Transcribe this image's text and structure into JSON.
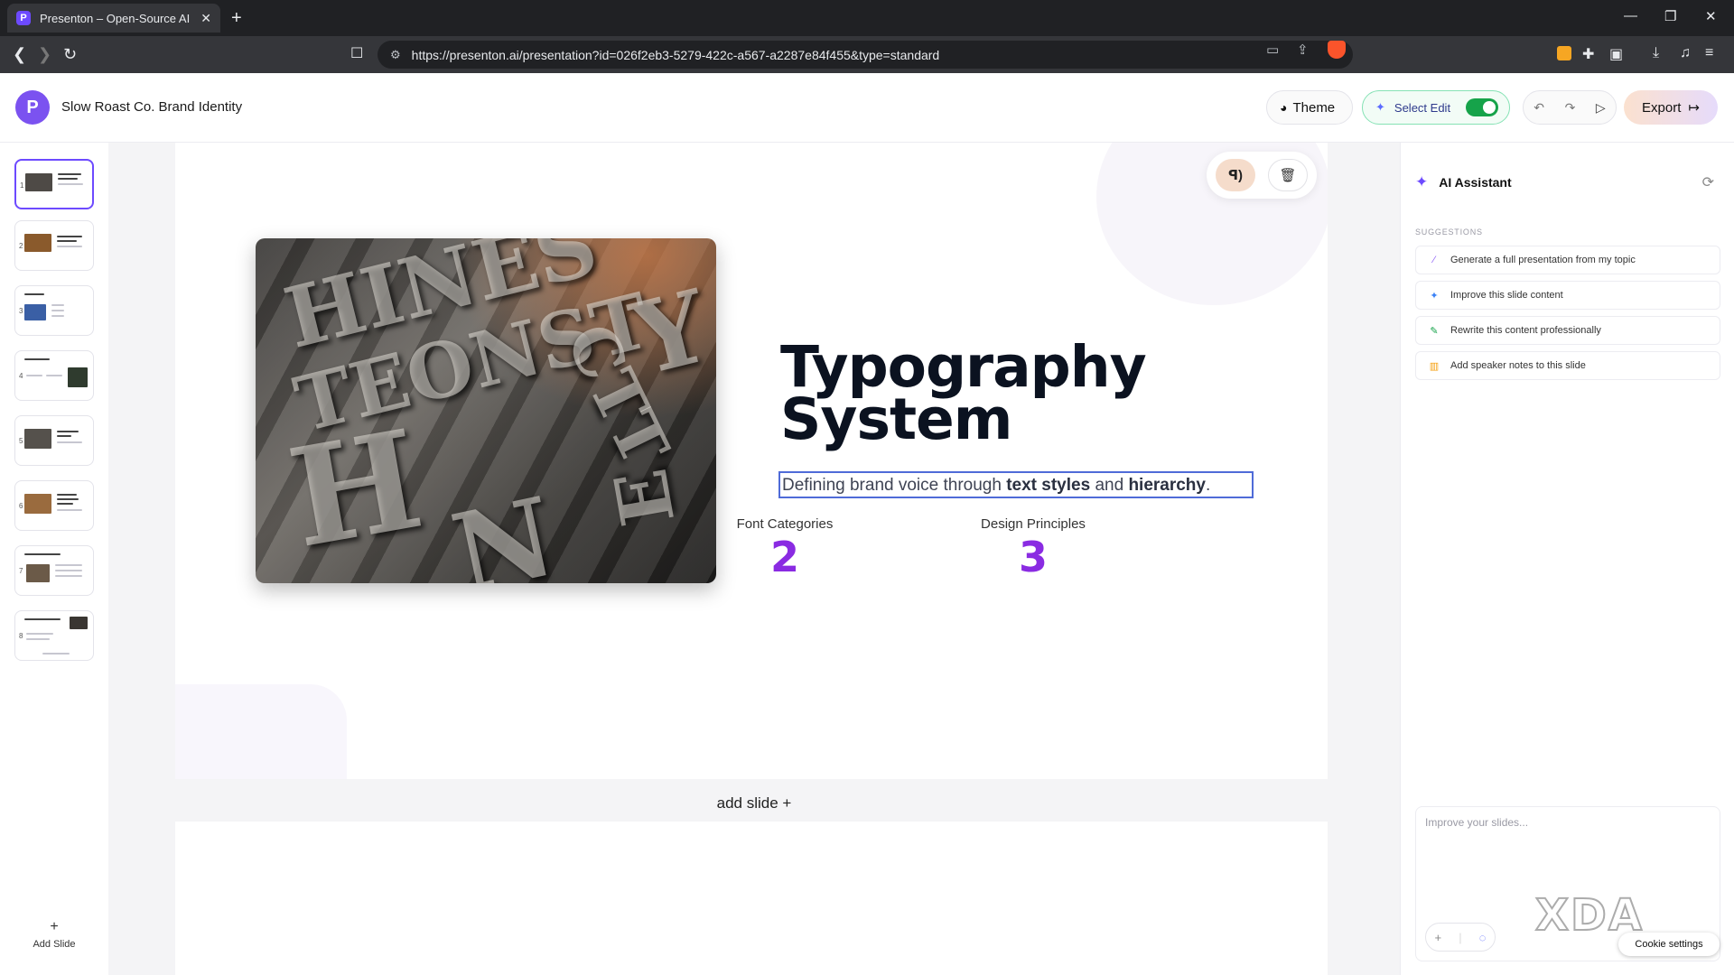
{
  "browser": {
    "tab_title": "Presenton – Open-Source AI Pre",
    "favicon_letter": "P",
    "url": "https://presenton.ai/presentation?id=026f2eb3-5279-422c-a567-a2287e84f455&type=standard"
  },
  "header": {
    "logo_letter": "P",
    "doc_title": "Slow Roast Co. Brand Identity",
    "theme_label": "Theme",
    "select_edit_label": "Select Edit",
    "select_edit_on": true,
    "export_label": "Export"
  },
  "sidebar": {
    "thumbnails": [
      {
        "num": "1",
        "active": true
      },
      {
        "num": "2",
        "active": false
      },
      {
        "num": "3",
        "active": false
      },
      {
        "num": "4",
        "active": false
      },
      {
        "num": "5",
        "active": false
      },
      {
        "num": "6",
        "active": false
      },
      {
        "num": "7",
        "active": false
      },
      {
        "num": "8",
        "active": false
      }
    ],
    "add_slide_label": "Add Slide"
  },
  "slide": {
    "title": "Typography System",
    "subtitle_parts": [
      "Defining brand voice through ",
      "text styles",
      " and ",
      "hierarchy",
      "."
    ],
    "stats": [
      {
        "label": "Font Categories",
        "value": "2"
      },
      {
        "label": "Design Principles",
        "value": "3"
      }
    ],
    "accent_color": "#8a2be2"
  },
  "canvas": {
    "add_slide_label": "add slide +"
  },
  "ai_panel": {
    "title": "AI Assistant",
    "suggestions_label": "SUGGESTIONS",
    "suggestions": [
      {
        "icon": "magic-wand-icon",
        "label": "Generate a full presentation from my topic"
      },
      {
        "icon": "sparkle-icon",
        "label": "Improve this slide content"
      },
      {
        "icon": "pen-icon",
        "label": "Rewrite this content professionally"
      },
      {
        "icon": "chart-icon",
        "label": "Add speaker notes to this slide"
      }
    ],
    "input_placeholder": "Improve your slides...",
    "cookie_settings_label": "Cookie settings"
  },
  "watermark": "XDA"
}
